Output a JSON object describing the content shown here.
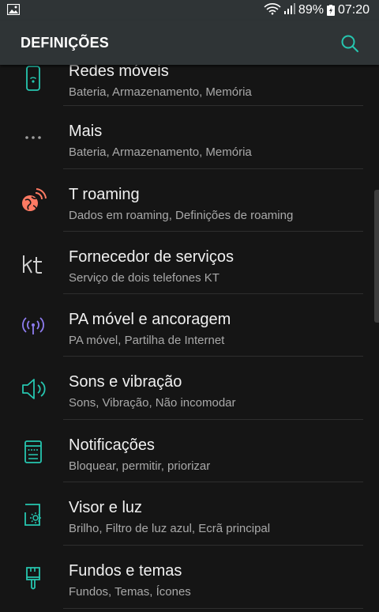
{
  "status_bar": {
    "battery": "89%",
    "time": "07:20",
    "icons": [
      "gallery-icon",
      "wifi-icon",
      "signal-icon",
      "battery-charging-icon"
    ]
  },
  "app_bar": {
    "title": "DEFINIÇÕES",
    "search_icon": "search-icon"
  },
  "items": [
    {
      "id": "redes-moveis",
      "icon": "network-phone-icon",
      "title": "Redes móveis",
      "subtitle": "Bateria, Armazenamento, Memória"
    },
    {
      "id": "mais",
      "icon": "more-dots-icon",
      "title": "Mais",
      "subtitle": "Bateria, Armazenamento, Memória"
    },
    {
      "id": "t-roaming",
      "icon": "globe-roaming-icon",
      "title": "T roaming",
      "subtitle": "Dados em roaming, Definições de roaming"
    },
    {
      "id": "fornecedor",
      "icon": "kt-logo-icon",
      "title": "Fornecedor de serviços",
      "subtitle": "Serviço de dois telefones KT"
    },
    {
      "id": "pa-movel",
      "icon": "hotspot-icon",
      "title": "PA móvel e ancoragem",
      "subtitle": "PA móvel, Partilha de Internet"
    },
    {
      "id": "sons",
      "icon": "speaker-icon",
      "title": "Sons e vibração",
      "subtitle": "Sons, Vibração, Não incomodar"
    },
    {
      "id": "notificacoes",
      "icon": "notification-panel-icon",
      "title": "Notificações",
      "subtitle": "Bloquear, permitir, priorizar"
    },
    {
      "id": "visor",
      "icon": "display-brightness-icon",
      "title": "Visor e luz",
      "subtitle": "Brilho, Filtro de luz azul, Ecrã principal"
    },
    {
      "id": "fundos",
      "icon": "paintbrush-icon",
      "title": "Fundos e temas",
      "subtitle": "Fundos, Temas, Ícones"
    }
  ],
  "colors": {
    "accent": "#26c6b0",
    "roaming": "#ff7a63",
    "hotspot": "#8e7cf0",
    "bar": "#2f3436",
    "background": "#151515"
  }
}
